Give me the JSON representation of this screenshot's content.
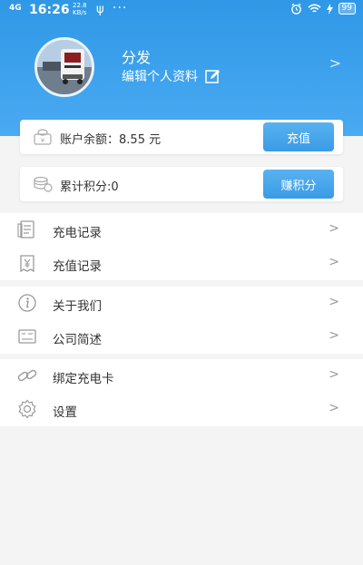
{
  "status_bar": {
    "network": "4G",
    "time": "16:26",
    "speed_value": "22.8",
    "speed_unit": "KB/s",
    "usb": "ψ",
    "more": "···",
    "battery": "99"
  },
  "profile": {
    "name": "分发",
    "edit_label": "编辑个人资料"
  },
  "balance": {
    "label": "账户余额：",
    "amount": "8.55",
    "unit": "元",
    "button": "充值"
  },
  "points": {
    "label": "累计积分:",
    "value": "0",
    "button": "赚积分"
  },
  "menu_groups": [
    {
      "items": [
        {
          "label": "充电记录",
          "icon": "document-list-icon"
        },
        {
          "label": "充值记录",
          "icon": "receipt-yen-icon"
        }
      ]
    },
    {
      "items": [
        {
          "label": "关于我们",
          "icon": "info-icon"
        },
        {
          "label": "公司简述",
          "icon": "company-card-icon"
        }
      ]
    },
    {
      "items": [
        {
          "label": "绑定充电卡",
          "icon": "link-icon"
        },
        {
          "label": "设置",
          "icon": "gear-icon"
        }
      ]
    }
  ],
  "colors": {
    "header_blue": "#3aa0ec",
    "button_blue": "#46a6eb",
    "icon_gray": "#999999"
  }
}
